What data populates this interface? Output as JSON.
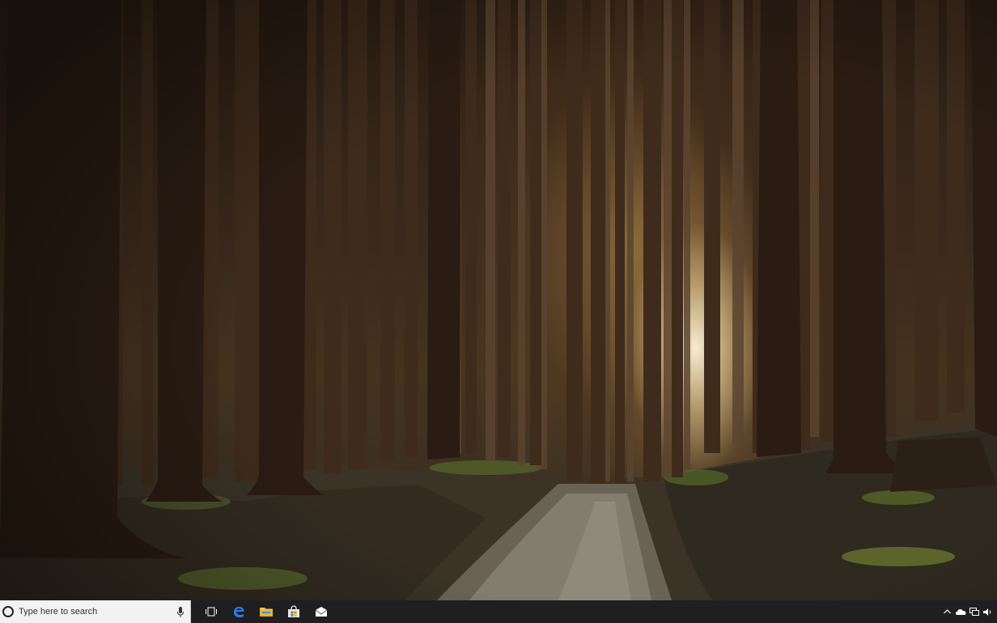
{
  "taskbar": {
    "search": {
      "placeholder": "Type here to search"
    },
    "pinned": [
      {
        "name": "task-view-icon"
      },
      {
        "name": "edge-icon"
      },
      {
        "name": "file-explorer-icon"
      },
      {
        "name": "store-icon"
      },
      {
        "name": "mail-icon"
      }
    ],
    "tray": [
      {
        "name": "chevron-up-icon"
      },
      {
        "name": "onedrive-icon"
      },
      {
        "name": "network-icon"
      },
      {
        "name": "volume-icon"
      }
    ]
  },
  "colors": {
    "taskbar": "#1e1e22",
    "search_box": "#f2f2f2",
    "edge_blue": "#2d7ee0",
    "explorer_yellow": "#f1c24a"
  }
}
